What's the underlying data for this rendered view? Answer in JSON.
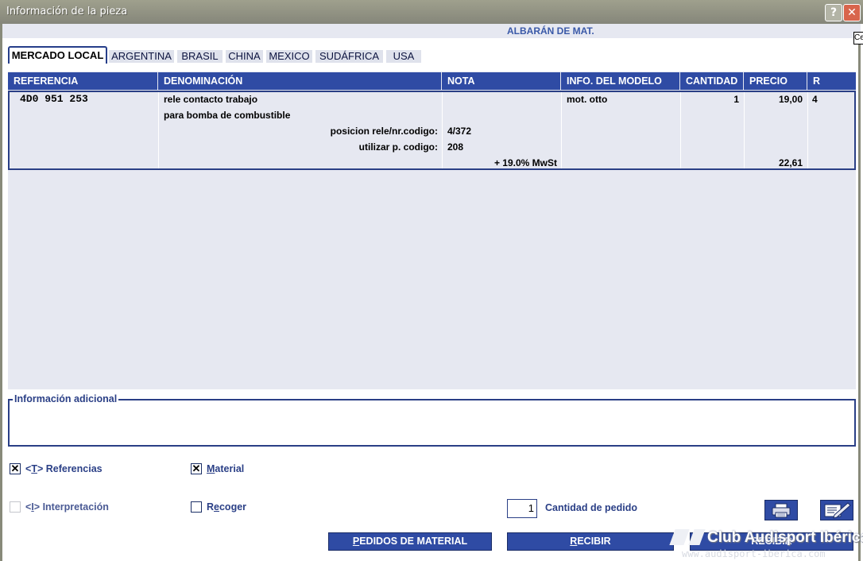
{
  "window": {
    "title": "Información de la pieza",
    "help_glyph": "?",
    "close_glyph": "✕"
  },
  "document_label": "ALBARÁN DE MAT.",
  "tooltip_fragment": "Ce",
  "tabs": [
    {
      "label": "MERCADO LOCAL",
      "active": true
    },
    {
      "label": "ARGENTINA"
    },
    {
      "label": "BRASIL"
    },
    {
      "label": "CHINA"
    },
    {
      "label": "MEXICO"
    },
    {
      "label": "SUDÁFRICA"
    },
    {
      "label": "USA"
    }
  ],
  "grid": {
    "columns": [
      "REFERENCIA",
      "DENOMINACIÓN",
      "NOTA",
      "INFO. DEL MODELO",
      "CANTIDAD",
      "PRECIO",
      "R"
    ],
    "row": {
      "referencia": "4D0 951 253",
      "denominacion_1": "rele contacto trabajo",
      "denominacion_2": "para bomba de combustible",
      "attr_1_label": "posicion rele/nr.codigo:",
      "attr_1_value": "4/372",
      "attr_2_label": "utilizar p. codigo:",
      "attr_2_value": "208",
      "tax_label": "+ 19.0% MwSt",
      "info_modelo": "mot. otto",
      "cantidad": "1",
      "precio": "19,00",
      "precio_total": "22,61",
      "r": "4"
    }
  },
  "info_adicional": {
    "label": "Información adicional"
  },
  "options": {
    "referencias": {
      "label_prefix": "<",
      "label_key": "T",
      "label_suffix": "> Referencias",
      "checked": "✕"
    },
    "material": {
      "label_key": "M",
      "label_rest": "aterial",
      "checked": "✕"
    },
    "interpretacion": {
      "label_prefix": "<",
      "label_key": "I",
      "label_suffix": "> Interpretación"
    },
    "recoger": {
      "label_first": "R",
      "label_key": "e",
      "label_rest": "coger"
    }
  },
  "order": {
    "quantity_value": "1",
    "quantity_label": "Cantidad de pedido"
  },
  "buttons": {
    "pedidos_key": "P",
    "pedidos_rest": "EDIDOS DE MATERIAL",
    "recibir_key": "R",
    "recibir_rest": "ECIBIR",
    "third_label": "RECIBIR"
  },
  "watermark": {
    "title": "Club Audisport Ibérica",
    "url": "www.audisport-iberica.com"
  }
}
